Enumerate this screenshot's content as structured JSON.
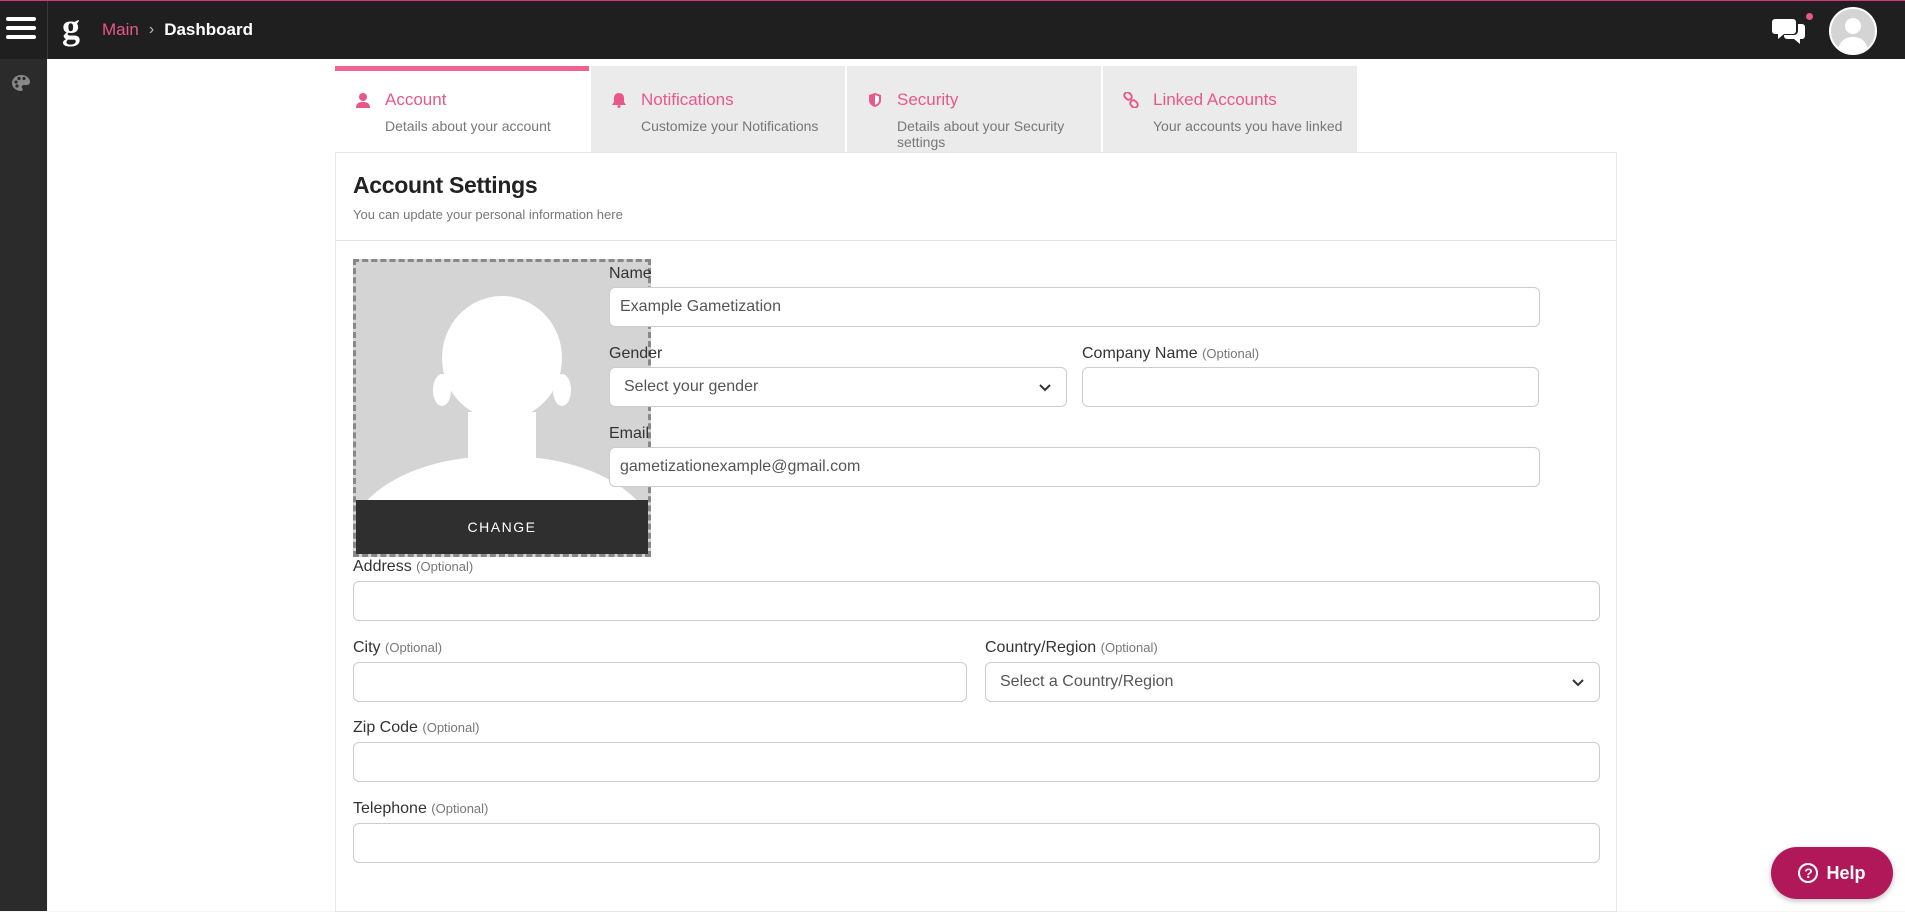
{
  "topbar": {
    "logo": "g",
    "breadcrumb": {
      "parent": "Main",
      "separator": "›",
      "current": "Dashboard"
    },
    "icons": {
      "menu": "hamburger-icon",
      "chat": "chat-bubbles-icon",
      "avatar": "user-avatar-icon"
    }
  },
  "sidebar": {
    "items": [
      {
        "icon": "palette-icon"
      }
    ]
  },
  "tabs": [
    {
      "title": "Account",
      "subtitle": "Details about your account",
      "icon": "user-icon",
      "active": true
    },
    {
      "title": "Notifications",
      "subtitle": "Customize your Notifications",
      "icon": "bell-icon",
      "active": false
    },
    {
      "title": "Security",
      "subtitle": "Details about your Security settings",
      "icon": "shield-icon",
      "active": false
    },
    {
      "title": "Linked Accounts",
      "subtitle": "Your accounts you have linked",
      "icon": "link-icon",
      "active": false
    }
  ],
  "panel": {
    "title": "Account Settings",
    "subtitle": "You can update your personal information here",
    "photo": {
      "change_label": "CHANGE"
    }
  },
  "form": {
    "optional_tag": "(Optional)",
    "name": {
      "label": "Name",
      "value": "Example Gametization"
    },
    "gender": {
      "label": "Gender",
      "value": "Select your gender"
    },
    "company": {
      "label": "Company Name",
      "value": ""
    },
    "email": {
      "label": "Email",
      "value": "gametizationexample@gmail.com"
    },
    "address": {
      "label": "Address",
      "value": ""
    },
    "city": {
      "label": "City",
      "value": ""
    },
    "country": {
      "label": "Country/Region",
      "value": "Select a Country/Region"
    },
    "zip": {
      "label": "Zip Code",
      "value": ""
    },
    "telephone": {
      "label": "Telephone",
      "value": ""
    }
  },
  "help": {
    "label": "Help",
    "q": "?"
  },
  "colors": {
    "accent": "#e8578a",
    "topbar": "#1f1f1f",
    "help": "#b0185a"
  }
}
